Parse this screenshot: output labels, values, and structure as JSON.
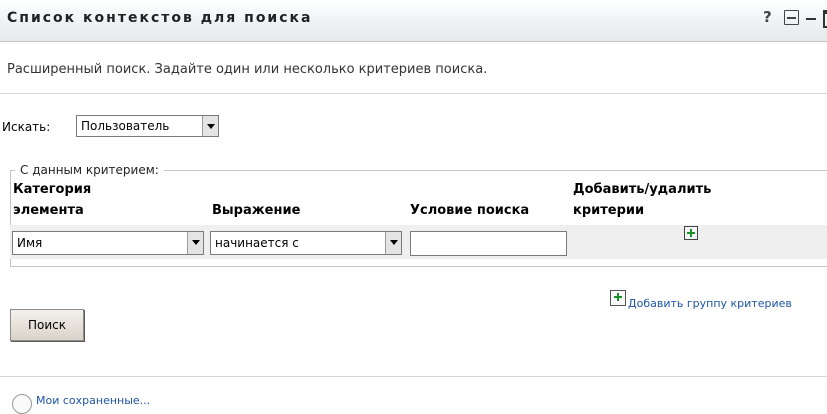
{
  "portlet": {
    "title": "Список контекстов для поиска",
    "controls": {
      "help": "?",
      "print_icon": "print-icon",
      "minimize_icon": "minimize-icon",
      "maximize_icon": "maximize-icon"
    }
  },
  "description": "Расширенный поиск. Задайте один или несколько критериев поиска.",
  "search_for": {
    "label": "Искать:",
    "selected": "Пользователь"
  },
  "criteria": {
    "legend": "С данным критерием:",
    "columns": {
      "category_line1": "Категория",
      "category_line2": "элемента",
      "expression": "Выражение",
      "condition": "Условие поиска",
      "add_remove_line1": "Добавить/удалить",
      "add_remove_line2": "критерии"
    },
    "row": {
      "category_selected": "Имя",
      "expression_selected": "начинается с",
      "condition_value": ""
    }
  },
  "add_group_label": "Добавить группу критериев",
  "search_button": "Поиск",
  "saved_searches_label": "Мои сохраненные..."
}
